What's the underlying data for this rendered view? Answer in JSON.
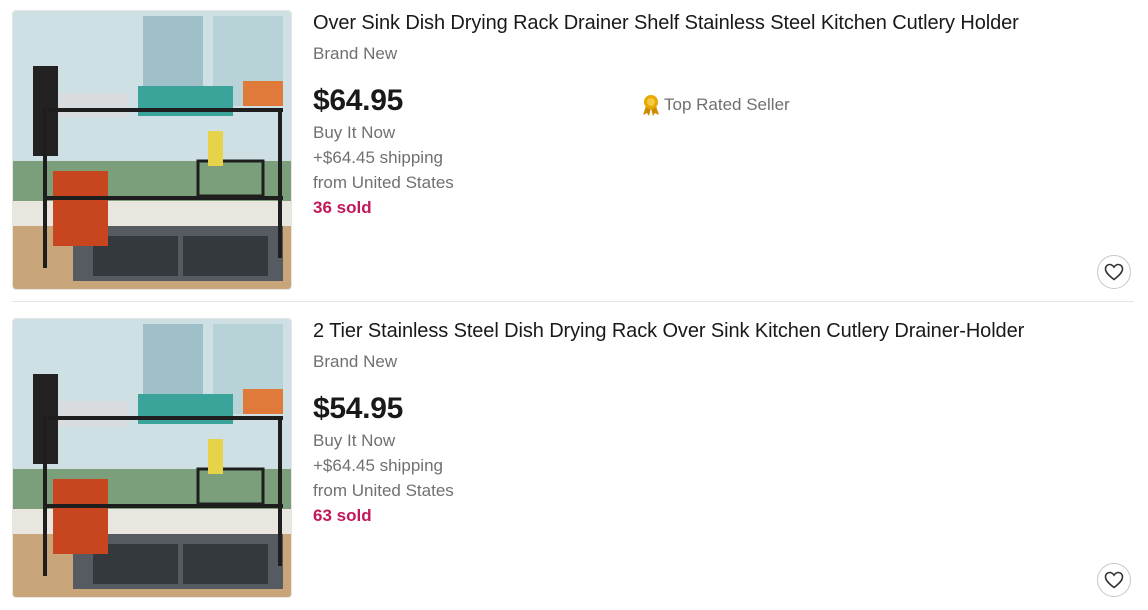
{
  "listings": [
    {
      "title": "Over Sink Dish Drying Rack Drainer Shelf Stainless Steel Kitchen Cutlery Holder",
      "condition": "Brand New",
      "price": "$64.95",
      "format": "Buy It Now",
      "shipping": "+$64.45 shipping",
      "location": "from United States",
      "sold": "36 sold",
      "badge": "Top Rated Seller",
      "image_icon": "dish-rack-photo",
      "favorite_icon": "heart-outline-icon"
    },
    {
      "title": "2 Tier Stainless Steel Dish Drying Rack Over Sink Kitchen Cutlery Drainer-Holder",
      "condition": "Brand New",
      "price": "$54.95",
      "format": "Buy It Now",
      "shipping": "+$64.45 shipping",
      "location": "from United States",
      "sold": "63 sold",
      "image_icon": "dish-rack-photo",
      "favorite_icon": "heart-outline-icon"
    }
  ],
  "colors": {
    "sold": "#c2185b",
    "secondary_text": "#707070",
    "primary_text": "#191919",
    "badge_gold": "#e8a800"
  }
}
